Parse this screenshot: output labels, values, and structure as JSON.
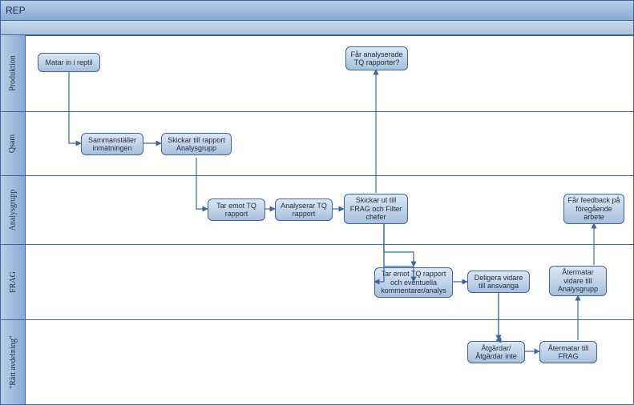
{
  "chart_data": {
    "type": "swimlane-flowchart",
    "title": "REP",
    "lanes": [
      "Produktion",
      "Qsam",
      "Analysgrupp",
      "FRAG",
      "\"Rätt avdelning\""
    ],
    "nodes": [
      {
        "id": "n1",
        "lane": "Produktion",
        "label": "Matar in i reptil"
      },
      {
        "id": "n2",
        "lane": "Produktion",
        "label": "Får analyserade TQ rapporter?"
      },
      {
        "id": "n3",
        "lane": "Qsam",
        "label": "Sammanställer inmatningen"
      },
      {
        "id": "n4",
        "lane": "Qsam",
        "label": "Skickar till rapport Analysgrupp"
      },
      {
        "id": "n5",
        "lane": "Analysgrupp",
        "label": "Tar emot TQ rapport"
      },
      {
        "id": "n6",
        "lane": "Analysgrupp",
        "label": "Analyserar TQ rapport"
      },
      {
        "id": "n7",
        "lane": "Analysgrupp",
        "label": "Skickar ut till FRAG och Filter chefer"
      },
      {
        "id": "n8",
        "lane": "Analysgrupp",
        "label": "Får feedback på föregående arbete"
      },
      {
        "id": "n9",
        "lane": "FRAG",
        "label": "Tar emot TQ rapport och eventuella kommentarer/analys"
      },
      {
        "id": "n10",
        "lane": "FRAG",
        "label": "Deligera vidare till ansvariga"
      },
      {
        "id": "n11",
        "lane": "FRAG",
        "label": "Återmatar vidare till Analysgrupp"
      },
      {
        "id": "n12",
        "lane": "\"Rätt avdelning\"",
        "label": "Åtgärdar/ Åtgärdar inte"
      },
      {
        "id": "n13",
        "lane": "\"Rätt avdelning\"",
        "label": "Återmatar till FRAG"
      }
    ],
    "edges": [
      [
        "n1",
        "n3"
      ],
      [
        "n3",
        "n4"
      ],
      [
        "n4",
        "n5"
      ],
      [
        "n5",
        "n6"
      ],
      [
        "n6",
        "n7"
      ],
      [
        "n7",
        "n2"
      ],
      [
        "n7",
        "n9"
      ],
      [
        "n9",
        "n10"
      ],
      [
        "n10",
        "n12"
      ],
      [
        "n12",
        "n13"
      ],
      [
        "n13",
        "n11"
      ],
      [
        "n11",
        "n8"
      ]
    ]
  },
  "title": "REP",
  "lanes": {
    "produktion": "Produktion",
    "qsam": "Qsam",
    "analysgrupp": "Analysgrupp",
    "frag": "FRAG",
    "ratt": "\"Rätt avdelning\""
  },
  "nodes": {
    "n1": "Matar in i reptil",
    "n2": "Får analyserade TQ rapporter?",
    "n3": "Sammanställer inmatningen",
    "n4": "Skickar till rapport Analysgrupp",
    "n5": "Tar emot TQ rapport",
    "n6": "Analyserar TQ rapport",
    "n7": "Skickar ut till FRAG och Filter chefer",
    "n8": "Får feedback på föregående arbete",
    "n9": "Tar emot TQ rapport och eventuella kommentarer/analys",
    "n10": "Deligera vidare till ansvariga",
    "n11": "Återmatar vidare till Analysgrupp",
    "n12": "Åtgärdar/ Åtgärdar inte",
    "n13": "Återmatar till FRAG"
  }
}
